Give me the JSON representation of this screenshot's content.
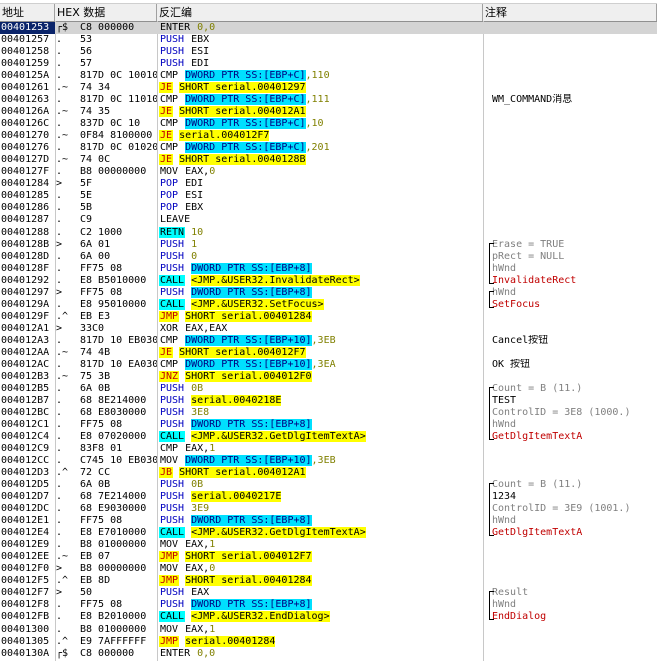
{
  "headers": {
    "addr": "地址",
    "hex": "HEX 数据",
    "disasm": "反汇编",
    "comment": "注释"
  },
  "rows": [
    {
      "addr": "00401253",
      "mark": "┌$",
      "hex": "C8 000000",
      "mn": "ENTER",
      "mk": "enter",
      "ops": [
        {
          "t": "0,0",
          "c": "num"
        }
      ],
      "sel": true
    },
    {
      "addr": "00401257",
      "mark": ".",
      "hex": "53",
      "mn": "PUSH",
      "mk": "push",
      "ops": [
        {
          "t": "EBX",
          "c": "reg"
        }
      ]
    },
    {
      "addr": "00401258",
      "mark": ".",
      "hex": "56",
      "mn": "PUSH",
      "mk": "push",
      "ops": [
        {
          "t": "ESI",
          "c": "reg"
        }
      ]
    },
    {
      "addr": "00401259",
      "mark": ".",
      "hex": "57",
      "mn": "PUSH",
      "mk": "push",
      "ops": [
        {
          "t": "EDI",
          "c": "reg"
        }
      ]
    },
    {
      "addr": "0040125A",
      "mark": ".",
      "hex": "817D 0C 10010",
      "mn": "CMP",
      "mk": "cmp",
      "ops": [
        {
          "t": "DWORD PTR SS:[EBP+C]",
          "c": "mem"
        },
        {
          "t": ",110",
          "c": "num"
        }
      ]
    },
    {
      "addr": "00401261",
      "mark": ".~",
      "hex": "74 34",
      "mn": "JE",
      "mk": "jump",
      "ops": [
        {
          "t": "SHORT serial.00401297",
          "c": "lbl"
        }
      ]
    },
    {
      "addr": "00401263",
      "mark": ".",
      "hex": "817D 0C 11010",
      "mn": "CMP",
      "mk": "cmp",
      "ops": [
        {
          "t": "DWORD PTR SS:[EBP+C]",
          "c": "mem"
        },
        {
          "t": ",111",
          "c": "num"
        }
      ],
      "cmt": "WM_COMMAND消息",
      "ck": "txt"
    },
    {
      "addr": "0040126A",
      "mark": ".~",
      "hex": "74 35",
      "mn": "JE",
      "mk": "jump",
      "ops": [
        {
          "t": "SHORT serial.004012A1",
          "c": "lbl"
        }
      ]
    },
    {
      "addr": "0040126C",
      "mark": ".",
      "hex": "837D 0C 10",
      "mn": "CMP",
      "mk": "cmp",
      "ops": [
        {
          "t": "DWORD PTR SS:[EBP+C]",
          "c": "mem"
        },
        {
          "t": ",10",
          "c": "num"
        }
      ]
    },
    {
      "addr": "00401270",
      "mark": ".~",
      "hex": "0F84 8100000",
      "mn": "JE",
      "mk": "jump",
      "ops": [
        {
          "t": "serial.004012F7",
          "c": "lbl"
        }
      ]
    },
    {
      "addr": "00401276",
      "mark": ".",
      "hex": "817D 0C 01020",
      "mn": "CMP",
      "mk": "cmp",
      "ops": [
        {
          "t": "DWORD PTR SS:[EBP+C]",
          "c": "mem"
        },
        {
          "t": ",201",
          "c": "num"
        }
      ]
    },
    {
      "addr": "0040127D",
      "mark": ".~",
      "hex": "74 0C",
      "mn": "JE",
      "mk": "jump",
      "ops": [
        {
          "t": "SHORT serial.0040128B",
          "c": "lbl"
        }
      ]
    },
    {
      "addr": "0040127F",
      "mark": ".",
      "hex": "B8 00000000",
      "mn": "MOV",
      "mk": "mov",
      "ops": [
        {
          "t": "EAX,",
          "c": "reg"
        },
        {
          "t": "0",
          "c": "num"
        }
      ]
    },
    {
      "addr": "00401284",
      "mark": ">",
      "hex": "5F",
      "mn": "POP",
      "mk": "push",
      "ops": [
        {
          "t": "EDI",
          "c": "reg"
        }
      ]
    },
    {
      "addr": "00401285",
      "mark": ".",
      "hex": "5E",
      "mn": "POP",
      "mk": "push",
      "ops": [
        {
          "t": "ESI",
          "c": "reg"
        }
      ]
    },
    {
      "addr": "00401286",
      "mark": ".",
      "hex": "5B",
      "mn": "POP",
      "mk": "push",
      "ops": [
        {
          "t": "EBX",
          "c": "reg"
        }
      ]
    },
    {
      "addr": "00401287",
      "mark": ".",
      "hex": "C9",
      "mn": "LEAVE",
      "mk": "mov",
      "ops": []
    },
    {
      "addr": "00401288",
      "mark": ".",
      "hex": "C2 1000",
      "mn": "RETN",
      "mk": "ret",
      "ops": [
        {
          "t": "10",
          "c": "num"
        }
      ]
    },
    {
      "addr": "0040128B",
      "mark": ">",
      "hex": "6A 01",
      "mn": "PUSH",
      "mk": "push",
      "ops": [
        {
          "t": "1",
          "c": "num"
        }
      ],
      "cmt": "Erase = TRUE",
      "ck": "arg"
    },
    {
      "addr": "0040128D",
      "mark": ".",
      "hex": "6A 00",
      "mn": "PUSH",
      "mk": "push",
      "ops": [
        {
          "t": "0",
          "c": "num"
        }
      ],
      "cmt": "pRect = NULL",
      "ck": "arg"
    },
    {
      "addr": "0040128F",
      "mark": ".",
      "hex": "FF75 08",
      "mn": "PUSH",
      "mk": "push",
      "ops": [
        {
          "t": "DWORD PTR SS:[EBP+8]",
          "c": "mem"
        }
      ],
      "cmt": "hWnd",
      "ck": "arg"
    },
    {
      "addr": "00401292",
      "mark": ".",
      "hex": "E8 B5010000",
      "mn": "CALL",
      "mk": "call",
      "ops": [
        {
          "t": "<JMP.&USER32.InvalidateRect>",
          "c": "lbl"
        }
      ],
      "cmt": "InvalidateRect",
      "ck": "fn"
    },
    {
      "addr": "00401297",
      "mark": ">",
      "hex": "FF75 08",
      "mn": "PUSH",
      "mk": "push",
      "ops": [
        {
          "t": "DWORD PTR SS:[EBP+8]",
          "c": "mem"
        }
      ],
      "cmt": "hWnd",
      "ck": "arg"
    },
    {
      "addr": "0040129A",
      "mark": ".",
      "hex": "E8 95010000",
      "mn": "CALL",
      "mk": "call",
      "ops": [
        {
          "t": "<JMP.&USER32.SetFocus>",
          "c": "lbl"
        }
      ],
      "cmt": "SetFocus",
      "ck": "fn"
    },
    {
      "addr": "0040129F",
      "mark": ".^",
      "hex": "EB E3",
      "mn": "JMP",
      "mk": "jump",
      "ops": [
        {
          "t": "SHORT serial.00401284",
          "c": "lbl"
        }
      ]
    },
    {
      "addr": "004012A1",
      "mark": ">",
      "hex": "33C0",
      "mn": "XOR",
      "mk": "mov",
      "ops": [
        {
          "t": "EAX,EAX",
          "c": "reg"
        }
      ]
    },
    {
      "addr": "004012A3",
      "mark": ".",
      "hex": "817D 10 EB030",
      "mn": "CMP",
      "mk": "cmp",
      "ops": [
        {
          "t": "DWORD PTR SS:[EBP+10]",
          "c": "mem"
        },
        {
          "t": ",3EB",
          "c": "num"
        }
      ],
      "cmt": "Cancel按钮",
      "ck": "txt"
    },
    {
      "addr": "004012AA",
      "mark": ".~",
      "hex": "74 4B",
      "mn": "JE",
      "mk": "jump",
      "ops": [
        {
          "t": "SHORT serial.004012F7",
          "c": "lbl"
        }
      ]
    },
    {
      "addr": "004012AC",
      "mark": ".",
      "hex": "817D 10 EA030",
      "mn": "CMP",
      "mk": "cmp",
      "ops": [
        {
          "t": "DWORD PTR SS:[EBP+10]",
          "c": "mem"
        },
        {
          "t": ",3EA",
          "c": "num"
        }
      ],
      "cmt": "OK 按钮",
      "ck": "txt"
    },
    {
      "addr": "004012B3",
      "mark": ".~",
      "hex": "75 3B",
      "mn": "JNZ",
      "mk": "jump",
      "ops": [
        {
          "t": "SHORT serial.004012F0",
          "c": "lbl"
        }
      ]
    },
    {
      "addr": "004012B5",
      "mark": ".",
      "hex": "6A 0B",
      "mn": "PUSH",
      "mk": "push",
      "ops": [
        {
          "t": "0B",
          "c": "num"
        }
      ],
      "cmt": "Count = B (11.)",
      "ck": "arg"
    },
    {
      "addr": "004012B7",
      "mark": ".",
      "hex": "68 8E214000",
      "mn": "PUSH",
      "mk": "push",
      "ops": [
        {
          "t": "serial.0040218E",
          "c": "lbl"
        }
      ],
      "cmt": "TEST",
      "ck": "txt"
    },
    {
      "addr": "004012BC",
      "mark": ".",
      "hex": "68 E8030000",
      "mn": "PUSH",
      "mk": "push",
      "ops": [
        {
          "t": "3E8",
          "c": "num"
        }
      ],
      "cmt": "ControlID = 3E8 (1000.)",
      "ck": "arg"
    },
    {
      "addr": "004012C1",
      "mark": ".",
      "hex": "FF75 08",
      "mn": "PUSH",
      "mk": "push",
      "ops": [
        {
          "t": "DWORD PTR SS:[EBP+8]",
          "c": "mem"
        }
      ],
      "cmt": "hWnd",
      "ck": "arg"
    },
    {
      "addr": "004012C4",
      "mark": ".",
      "hex": "E8 07020000",
      "mn": "CALL",
      "mk": "call",
      "ops": [
        {
          "t": "<JMP.&USER32.GetDlgItemTextA>",
          "c": "lbl"
        }
      ],
      "cmt": "GetDlgItemTextA",
      "ck": "fn"
    },
    {
      "addr": "004012C9",
      "mark": ".",
      "hex": "83F8 01",
      "mn": "CMP",
      "mk": "cmp",
      "ops": [
        {
          "t": "EAX,",
          "c": "reg"
        },
        {
          "t": "1",
          "c": "num"
        }
      ]
    },
    {
      "addr": "004012CC",
      "mark": ".",
      "hex": "C745 10 EB030",
      "mn": "MOV",
      "mk": "mov",
      "ops": [
        {
          "t": "DWORD PTR SS:[EBP+10]",
          "c": "mem"
        },
        {
          "t": ",3EB",
          "c": "num"
        }
      ]
    },
    {
      "addr": "004012D3",
      "mark": ".^",
      "hex": "72 CC",
      "mn": "JB",
      "mk": "jump",
      "ops": [
        {
          "t": "SHORT serial.004012A1",
          "c": "lbl"
        }
      ]
    },
    {
      "addr": "004012D5",
      "mark": ".",
      "hex": "6A 0B",
      "mn": "PUSH",
      "mk": "push",
      "ops": [
        {
          "t": "0B",
          "c": "num"
        }
      ],
      "cmt": "Count = B (11.)",
      "ck": "arg"
    },
    {
      "addr": "004012D7",
      "mark": ".",
      "hex": "68 7E214000",
      "mn": "PUSH",
      "mk": "push",
      "ops": [
        {
          "t": "serial.0040217E",
          "c": "lbl"
        }
      ],
      "cmt": "1234",
      "ck": "txt"
    },
    {
      "addr": "004012DC",
      "mark": ".",
      "hex": "68 E9030000",
      "mn": "PUSH",
      "mk": "push",
      "ops": [
        {
          "t": "3E9",
          "c": "num"
        }
      ],
      "cmt": "ControlID = 3E9 (1001.)",
      "ck": "arg"
    },
    {
      "addr": "004012E1",
      "mark": ".",
      "hex": "FF75 08",
      "mn": "PUSH",
      "mk": "push",
      "ops": [
        {
          "t": "DWORD PTR SS:[EBP+8]",
          "c": "mem"
        }
      ],
      "cmt": "hWnd",
      "ck": "arg"
    },
    {
      "addr": "004012E4",
      "mark": ".",
      "hex": "E8 E7010000",
      "mn": "CALL",
      "mk": "call",
      "ops": [
        {
          "t": "<JMP.&USER32.GetDlgItemTextA>",
          "c": "lbl"
        }
      ],
      "cmt": "GetDlgItemTextA",
      "ck": "fn"
    },
    {
      "addr": "004012E9",
      "mark": ".",
      "hex": "B8 01000000",
      "mn": "MOV",
      "mk": "mov",
      "ops": [
        {
          "t": "EAX,",
          "c": "reg"
        },
        {
          "t": "1",
          "c": "num"
        }
      ]
    },
    {
      "addr": "004012EE",
      "mark": ".~",
      "hex": "EB 07",
      "mn": "JMP",
      "mk": "jump",
      "ops": [
        {
          "t": "SHORT serial.004012F7",
          "c": "lbl"
        }
      ]
    },
    {
      "addr": "004012F0",
      "mark": ">",
      "hex": "B8 00000000",
      "mn": "MOV",
      "mk": "mov",
      "ops": [
        {
          "t": "EAX,",
          "c": "reg"
        },
        {
          "t": "0",
          "c": "num"
        }
      ]
    },
    {
      "addr": "004012F5",
      "mark": ".^",
      "hex": "EB 8D",
      "mn": "JMP",
      "mk": "jump",
      "ops": [
        {
          "t": "SHORT serial.00401284",
          "c": "lbl"
        }
      ]
    },
    {
      "addr": "004012F7",
      "mark": ">",
      "hex": "50",
      "mn": "PUSH",
      "mk": "push",
      "ops": [
        {
          "t": "EAX",
          "c": "reg"
        }
      ],
      "cmt": "Result",
      "ck": "arg"
    },
    {
      "addr": "004012F8",
      "mark": ".",
      "hex": "FF75 08",
      "mn": "PUSH",
      "mk": "push",
      "ops": [
        {
          "t": "DWORD PTR SS:[EBP+8]",
          "c": "mem"
        }
      ],
      "cmt": "hWnd",
      "ck": "arg"
    },
    {
      "addr": "004012FB",
      "mark": ".",
      "hex": "E8 B2010000",
      "mn": "CALL",
      "mk": "call",
      "ops": [
        {
          "t": "<JMP.&USER32.EndDialog>",
          "c": "lbl"
        }
      ],
      "cmt": "EndDialog",
      "ck": "fn"
    },
    {
      "addr": "00401300",
      "mark": ".",
      "hex": "B8 01000000",
      "mn": "MOV",
      "mk": "mov",
      "ops": [
        {
          "t": "EAX,",
          "c": "reg"
        },
        {
          "t": "1",
          "c": "num"
        }
      ]
    },
    {
      "addr": "00401305",
      "mark": ".^",
      "hex": "E9 7AFFFFFF",
      "mn": "JMP",
      "mk": "jump",
      "ops": [
        {
          "t": "serial.00401284",
          "c": "lbl"
        }
      ]
    },
    {
      "addr": "0040130A",
      "mark": "┌$",
      "hex": "C8 000000",
      "mn": "ENTER",
      "mk": "enter",
      "ops": [
        {
          "t": "0,0",
          "c": "num"
        }
      ]
    }
  ]
}
